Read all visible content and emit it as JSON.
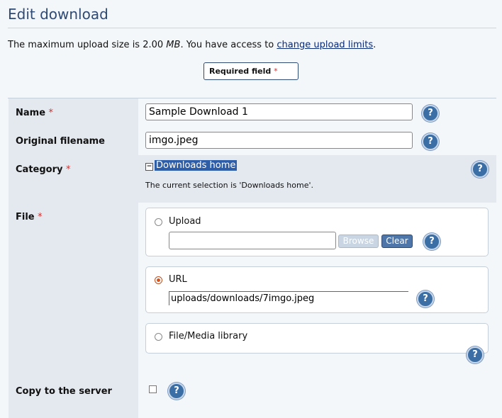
{
  "page": {
    "title": "Edit download",
    "limits_prefix": "The maximum upload size is 2.00 ",
    "limits_unit": "MB",
    "limits_middle": ". You have access to ",
    "limits_link": "change upload limits",
    "limits_suffix": ".",
    "required_label": "Required field",
    "required_star": "*"
  },
  "form": {
    "name": {
      "label": "Name",
      "star": "*",
      "value": "Sample Download 1"
    },
    "original_filename": {
      "label": "Original filename",
      "value": "imgo.jpeg"
    },
    "category": {
      "label": "Category",
      "star": "*",
      "toggle": "−",
      "tree_item": "Downloads home",
      "selection_text": "The current selection is 'Downloads home'."
    },
    "file": {
      "label": "File",
      "star": "*",
      "upload": {
        "label": "Upload",
        "value": "",
        "browse": "Browse",
        "clear": "Clear",
        "selected": false
      },
      "url": {
        "label": "URL",
        "value": "uploads/downloads/7imgo.jpeg",
        "selected": true
      },
      "media": {
        "label": "File/Media library",
        "selected": false
      }
    },
    "copy": {
      "label": "Copy to the server",
      "checked": false
    },
    "help_glyph": "?"
  },
  "colors": {
    "accent": "#2f4a73",
    "help": "#3b6ea5",
    "required": "#cc3333",
    "selection": "#2f5ea8"
  }
}
